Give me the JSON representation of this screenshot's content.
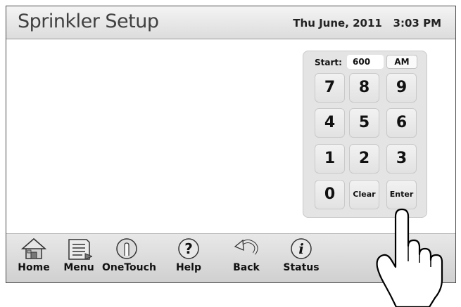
{
  "header": {
    "title": "Sprinkler Setup",
    "date": "Thu June, 2011",
    "time": "3:03 PM"
  },
  "keypad": {
    "start_label": "Start:",
    "start_value": "600",
    "ampm": "AM",
    "keys": [
      "7",
      "8",
      "9",
      "4",
      "5",
      "6",
      "1",
      "2",
      "3",
      "0",
      "Clear",
      "Enter"
    ]
  },
  "taskbar": {
    "items": [
      {
        "label": "Home",
        "icon": "home-icon"
      },
      {
        "label": "Menu",
        "icon": "menu-icon"
      },
      {
        "label": "OneTouch",
        "icon": "onetouch-icon"
      },
      {
        "label": "Help",
        "icon": "help-icon"
      },
      {
        "label": "Back",
        "icon": "back-icon"
      },
      {
        "label": "Status",
        "icon": "status-icon"
      }
    ]
  },
  "pointer": {
    "icon": "hand-pointer-icon",
    "target": "Enter"
  }
}
